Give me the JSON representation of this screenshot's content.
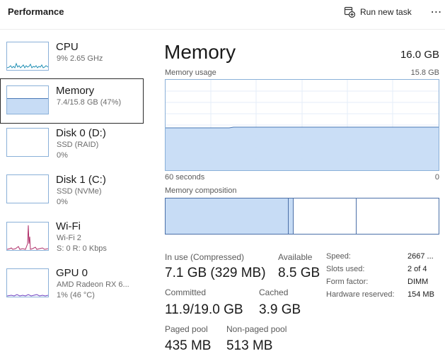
{
  "header": {
    "title": "Performance",
    "run_new_task_label": "Run new task"
  },
  "sidebar": {
    "items": [
      {
        "name": "CPU",
        "sub1": "9% 2.65 GHz",
        "sub2": ""
      },
      {
        "name": "Memory",
        "sub1": "7.4/15.8 GB (47%)",
        "sub2": ""
      },
      {
        "name": "Disk 0 (D:)",
        "sub1": "SSD (RAID)",
        "sub2": "0%"
      },
      {
        "name": "Disk 1 (C:)",
        "sub1": "SSD (NVMe)",
        "sub2": "0%"
      },
      {
        "name": "Wi-Fi",
        "sub1": "Wi-Fi 2",
        "sub2": "S: 0 R: 0 Kbps"
      },
      {
        "name": "GPU 0",
        "sub1": "AMD Radeon RX 6...",
        "sub2": "1% (46 °C)"
      }
    ]
  },
  "memory": {
    "title": "Memory",
    "total": "16.0 GB",
    "usage_label": "Memory usage",
    "usage_max": "15.8 GB",
    "axis_left": "60 seconds",
    "axis_right": "0",
    "usage_fraction": 0.47,
    "composition_label": "Memory composition",
    "composition": {
      "in_use_fraction": 0.45,
      "modified_fraction": 0.02,
      "standby_fraction": 0.23
    },
    "stats": {
      "in_use_label": "In use (Compressed)",
      "in_use_value": "7.1 GB (329 MB)",
      "available_label": "Available",
      "available_value": "8.5 GB",
      "committed_label": "Committed",
      "committed_value": "11.9/19.0 GB",
      "cached_label": "Cached",
      "cached_value": "3.9 GB",
      "paged_label": "Paged pool",
      "paged_value": "435 MB",
      "nonpaged_label": "Non-paged pool",
      "nonpaged_value": "513 MB"
    },
    "details": [
      {
        "label": "Speed:",
        "value": "2667 ..."
      },
      {
        "label": "Slots used:",
        "value": "2 of 4"
      },
      {
        "label": "Form factor:",
        "value": "DIMM"
      },
      {
        "label": "Hardware reserved:",
        "value": "154 MB"
      }
    ]
  },
  "colors": {
    "memory_fill": "#c7dcf5",
    "memory_line": "#4a78b5",
    "graph_border": "#8ab0d8",
    "cpu_line": "#1f8fb4",
    "wifi_line": "#b0306a",
    "gpu_line": "#6a3fc0"
  }
}
